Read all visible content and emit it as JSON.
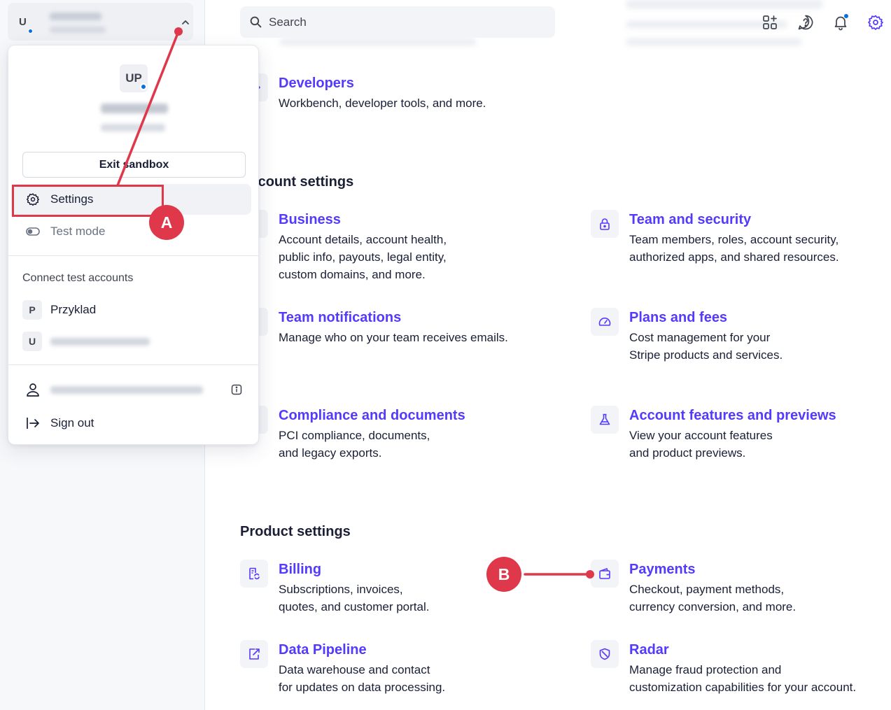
{
  "header": {
    "search_placeholder": "Search"
  },
  "account_menu": {
    "switcher_initial": "U",
    "avatar_initials": "UP",
    "exit_sandbox_label": "Exit sandbox",
    "settings_label": "Settings",
    "test_mode_label": "Test mode",
    "connect_section_label": "Connect test accounts",
    "accounts": [
      {
        "badge": "P",
        "name": "Przyklad"
      },
      {
        "badge": "U",
        "name": ""
      }
    ],
    "sign_out_label": "Sign out"
  },
  "settings": {
    "developers": {
      "title": "Developers",
      "desc": "Workbench, developer tools, and more.",
      "icon": "code-icon"
    },
    "account_section_title": "Account settings",
    "account_cards": [
      {
        "title": "Business",
        "desc": [
          "Account details, account health,",
          "public info, payouts, legal entity,",
          "custom domains, and more."
        ],
        "icon": "building-icon"
      },
      {
        "title": "Team and security",
        "desc": [
          "Team members, roles, account security,",
          "authorized apps, and shared resources."
        ],
        "icon": "lock-icon"
      },
      {
        "title": "Team notifications",
        "desc": [
          "Manage who on your team receives emails."
        ],
        "icon": "bell-icon"
      },
      {
        "title": "Plans and fees",
        "desc": [
          "Cost management for your",
          "Stripe products and services."
        ],
        "icon": "gauge-icon"
      },
      {
        "title": "Compliance and documents",
        "desc": [
          "PCI compliance, documents,",
          "and legacy exports."
        ],
        "icon": "document-icon"
      },
      {
        "title": "Account features and previews",
        "desc": [
          "View your account features",
          "and product previews."
        ],
        "icon": "flask-icon"
      }
    ],
    "product_section_title": "Product settings",
    "product_cards": [
      {
        "title": "Billing",
        "desc": [
          "Subscriptions, invoices,",
          "quotes, and customer portal."
        ],
        "icon": "billing-icon"
      },
      {
        "title": "Payments",
        "desc": [
          "Checkout, payment methods,",
          "currency conversion, and more."
        ],
        "icon": "wallet-icon"
      },
      {
        "title": "Data Pipeline",
        "desc": [
          "Data warehouse and contact",
          "for updates on data processing."
        ],
        "icon": "data-pipeline-icon"
      },
      {
        "title": "Radar",
        "desc": [
          "Manage fraud protection and",
          "customization capabilities for your account."
        ],
        "icon": "shield-icon"
      }
    ]
  },
  "annotations": {
    "badge_a": "A",
    "badge_b": "B",
    "color": "#e0384b"
  },
  "colors": {
    "accent": "#533afd",
    "text": "#1a1f36",
    "status_dot": "#0570de"
  }
}
